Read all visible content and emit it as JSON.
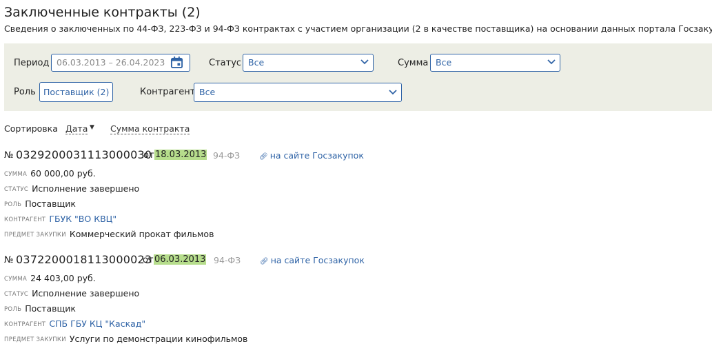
{
  "header": {
    "title": "Заключенные контракты (2)",
    "subtitle": "Сведения о заключенных по 44-ФЗ, 223-ФЗ и 94-ФЗ контрактах с участием организации (2 в качестве поставщика) на основании данных портала Госзакупок",
    "help_icon": "question-circle-icon"
  },
  "filters": {
    "period": {
      "label": "Период",
      "value": "06.03.2013 – 26.04.2023",
      "icon": "calendar-icon"
    },
    "status": {
      "label": "Статус",
      "value": "Все"
    },
    "sum": {
      "label": "Сумма",
      "value": "Все"
    },
    "role": {
      "label": "Роль",
      "value": "Поставщик (2)"
    },
    "counterparty": {
      "label": "Контрагент",
      "value": "Все"
    }
  },
  "sort": {
    "label": "Сортировка",
    "options": [
      {
        "label": "Дата",
        "active": true,
        "direction": "desc"
      },
      {
        "label": "Сумма контракта",
        "active": false
      }
    ]
  },
  "contract_labels": {
    "no_sign": "№",
    "ot": "от",
    "sum": "сумма",
    "status": "статус",
    "role": "роль",
    "counterparty": "контрагент",
    "subject": "предмет закупки",
    "link": "на сайте Госзакупок"
  },
  "contracts": [
    {
      "number": "0329200031113000030",
      "date": "18.03.2013",
      "law": "94-ФЗ",
      "sum": "60 000,00 руб.",
      "status": "Исполнение завершено",
      "role": "Поставщик",
      "counterparty": "ГБУК \"ВО КВЦ\"",
      "subject": "Коммерческий прокат фильмов"
    },
    {
      "number": "0372200018113000023",
      "date": "06.03.2013",
      "law": "94-ФЗ",
      "sum": "24 403,00 руб.",
      "status": "Исполнение завершено",
      "role": "Поставщик",
      "counterparty": "СПБ ГБУ КЦ \"Каскад\"",
      "subject": "Услуги по демонстрации кинофильмов"
    }
  ],
  "colors": {
    "accent": "#2f63a6",
    "panel_bg": "#edeee5",
    "date_highlight": "#b6dd8c"
  }
}
